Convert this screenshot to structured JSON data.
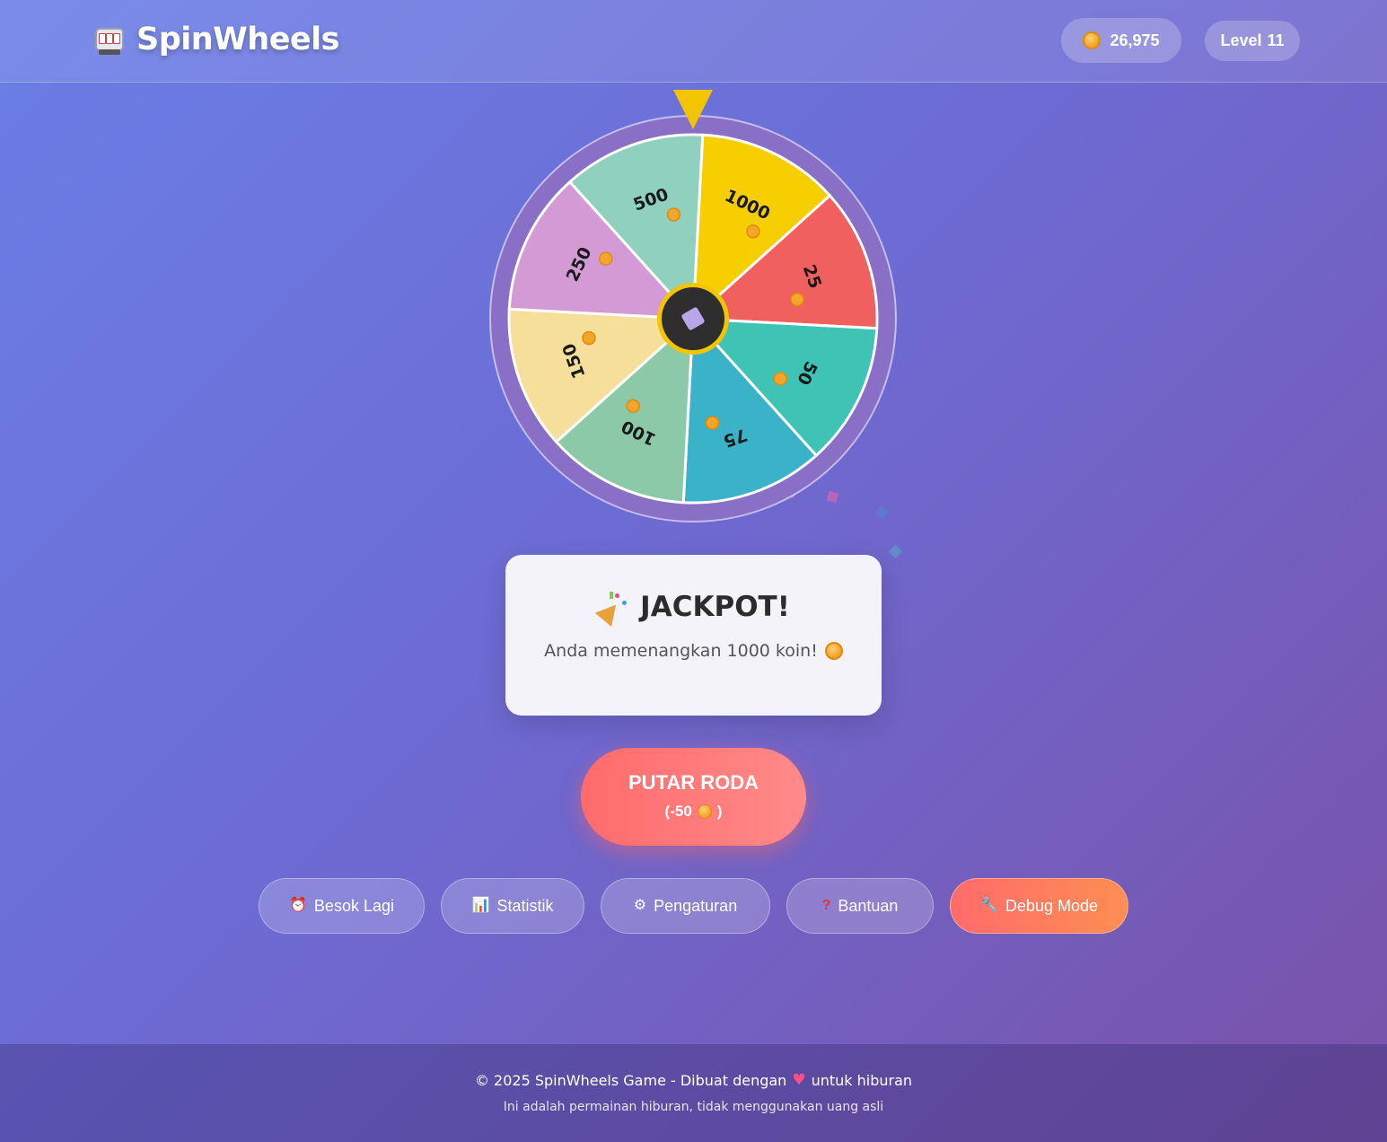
{
  "header": {
    "app_title": "SpinWheels",
    "coins": "26,975",
    "level_label": "Level",
    "level_value": "11"
  },
  "wheel": {
    "segments": [
      {
        "value": "1000",
        "color": "#f7cf00"
      },
      {
        "value": "25",
        "color": "#f0605f"
      },
      {
        "value": "50",
        "color": "#3ec3b5"
      },
      {
        "value": "75",
        "color": "#3ab3c9"
      },
      {
        "value": "100",
        "color": "#8cc9a9"
      },
      {
        "value": "150",
        "color": "#f5df9a"
      },
      {
        "value": "250",
        "color": "#d39ad6"
      },
      {
        "value": "500",
        "color": "#8fd0bf"
      }
    ],
    "rim_color": "#8a6fc7",
    "hub_color": "#2e2e2e",
    "pointer_color": "#f2c500"
  },
  "result": {
    "title": "JACKPOT!",
    "message": "Anda memenangkan 1000 koin!"
  },
  "spin_button": {
    "label": "PUTAR RODA",
    "cost_prefix": "(-50",
    "cost_suffix": ")"
  },
  "actions": [
    {
      "label": "Besok Lagi",
      "icon": "alarm-clock-icon"
    },
    {
      "label": "Statistik",
      "icon": "bar-chart-icon"
    },
    {
      "label": "Pengaturan",
      "icon": "gear-icon"
    },
    {
      "label": "Bantuan",
      "icon": "question-mark-icon"
    },
    {
      "label": "Debug Mode",
      "icon": "wrench-icon"
    }
  ],
  "footer": {
    "line1_before": "© 2025 SpinWheels Game - Dibuat dengan",
    "line1_after": "untuk hiburan",
    "line2": "Ini adalah permainan hiburan, tidak menggunakan uang asli"
  }
}
